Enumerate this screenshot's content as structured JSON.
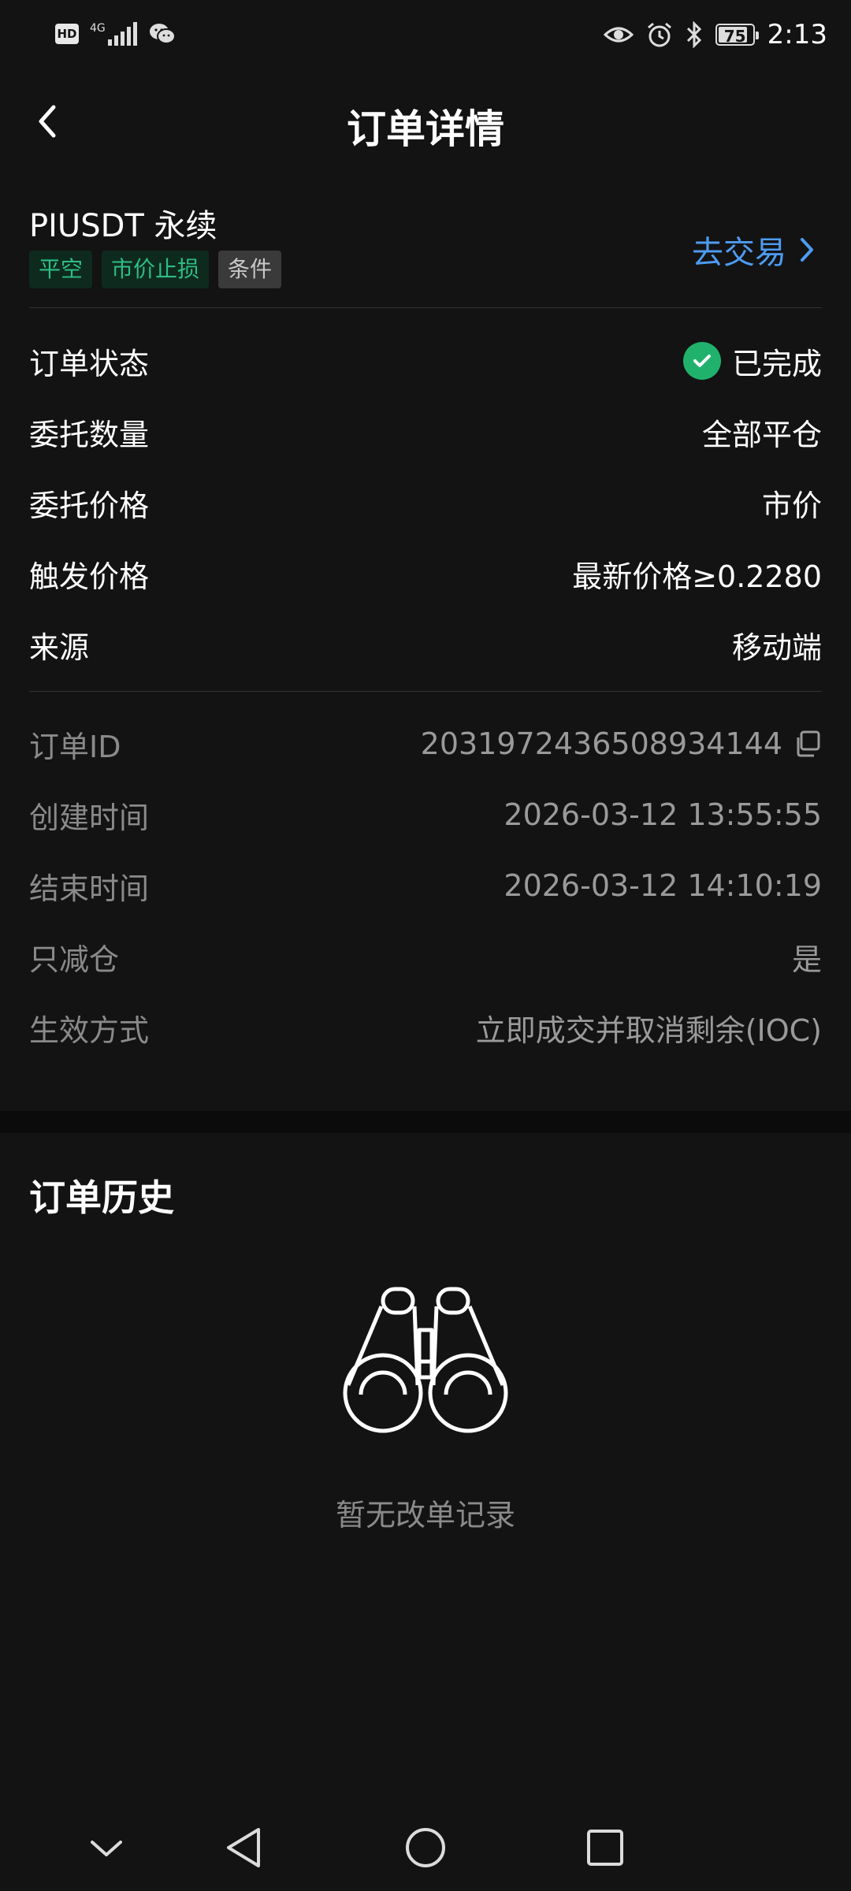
{
  "status_bar": {
    "left_badge": "HD",
    "network": "4G",
    "battery": "75",
    "time": "2:13",
    "icons": [
      "hd-icon",
      "signal-icon",
      "wechat-icon",
      "eye-icon",
      "alarm-icon",
      "bluetooth-icon",
      "battery-icon"
    ]
  },
  "header": {
    "title": "订单详情",
    "back_icon": "chevron-left-icon"
  },
  "order": {
    "symbol": "PIUSDT 永续",
    "tags": [
      "平空",
      "市价止损",
      "条件"
    ],
    "trade_link": "去交易",
    "details": [
      {
        "label": "订单状态",
        "value": "已完成"
      },
      {
        "label": "委托数量",
        "value": "全部平仓"
      },
      {
        "label": "委托价格",
        "value": "市价"
      },
      {
        "label": "触发价格",
        "value": "最新价格≥0.2280"
      },
      {
        "label": "来源",
        "value": "移动端"
      }
    ],
    "meta": [
      {
        "label": "订单ID",
        "value": "2031972436508934144"
      },
      {
        "label": "创建时间",
        "value": "2026-03-12 13:55:55"
      },
      {
        "label": "结束时间",
        "value": "2026-03-12 14:10:19"
      },
      {
        "label": "只减仓",
        "value": "是"
      },
      {
        "label": "生效方式",
        "value": "立即成交并取消剩余(IOC)"
      }
    ]
  },
  "history": {
    "title": "订单历史",
    "empty_text": "暂无改单记录",
    "empty_icon": "binoculars-icon"
  },
  "colors": {
    "background": "#131313",
    "accent_blue": "#4e9cf2",
    "success_green": "#20b26c",
    "tag_green": "#2ebd85"
  }
}
